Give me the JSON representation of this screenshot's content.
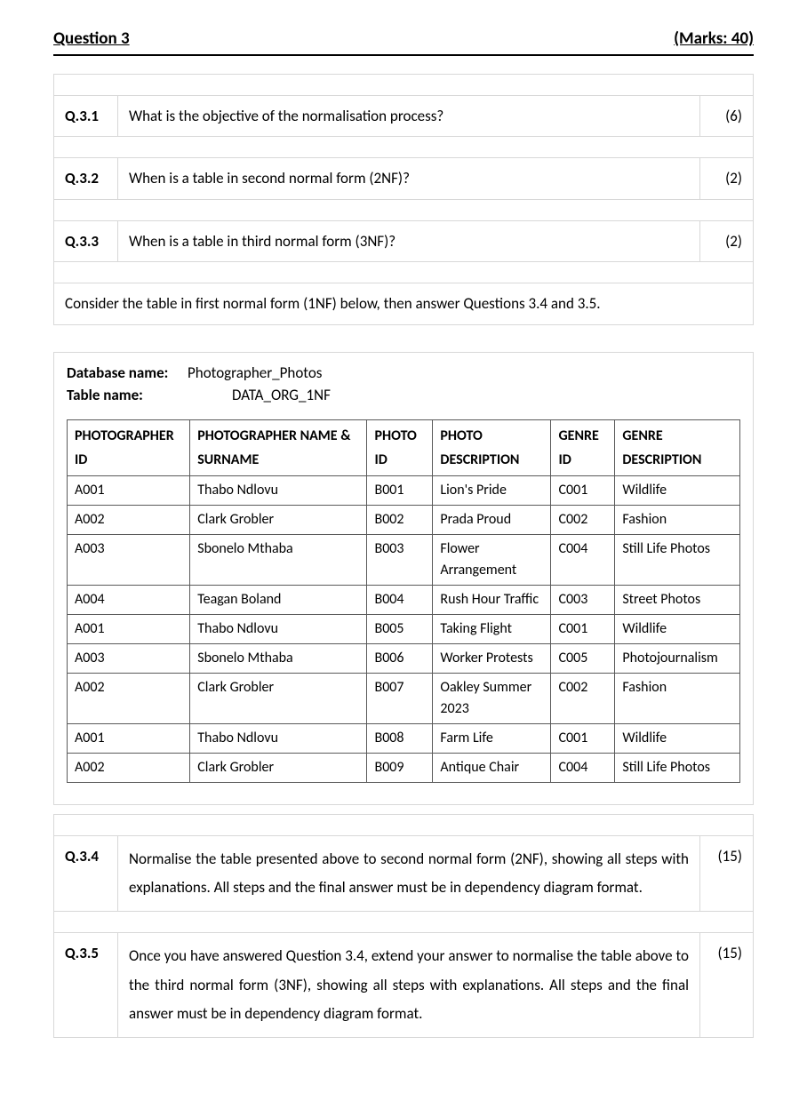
{
  "header": {
    "title": "Question 3",
    "marks": "(Marks: 40)"
  },
  "q31": {
    "num": "Q.3.1",
    "text": "What is the objective of the normalisation process?",
    "marks": "(6)"
  },
  "q32": {
    "num": "Q.3.2",
    "text": "When is a table in second normal form (2NF)?",
    "marks": "(2)"
  },
  "q33": {
    "num": "Q.3.3",
    "text": "When is a table in third normal form (3NF)?",
    "marks": "(2)"
  },
  "instruction": "Consider the table in first normal form (1NF) below, then answer Questions 3.4 and 3.5.",
  "db": {
    "name_label": "Database name:",
    "name_value": "Photographer_Photos",
    "table_label": "Table name:",
    "table_value": "DATA_ORG_1NF"
  },
  "columns": {
    "c1": "PHOTOGRAPHER ID",
    "c2": "PHOTOGRAPHER NAME & SURNAME",
    "c3": "PHOTO ID",
    "c4": "PHOTO DESCRIPTION",
    "c5": "GENRE ID",
    "c6": "GENRE DESCRIPTION"
  },
  "rows": [
    {
      "c1": "A001",
      "c2": "Thabo Ndlovu",
      "c3": "B001",
      "c4": "Lion's Pride",
      "c5": "C001",
      "c6": "Wildlife"
    },
    {
      "c1": "A002",
      "c2": "Clark Grobler",
      "c3": "B002",
      "c4": "Prada Proud",
      "c5": "C002",
      "c6": "Fashion"
    },
    {
      "c1": "A003",
      "c2": "Sbonelo Mthaba",
      "c3": "B003",
      "c4": "Flower Arrangement",
      "c5": "C004",
      "c6": "Still Life Photos"
    },
    {
      "c1": "A004",
      "c2": "Teagan Boland",
      "c3": "B004",
      "c4": "Rush Hour Traffic",
      "c5": "C003",
      "c6": "Street Photos"
    },
    {
      "c1": "A001",
      "c2": "Thabo Ndlovu",
      "c3": "B005",
      "c4": "Taking Flight",
      "c5": "C001",
      "c6": "Wildlife"
    },
    {
      "c1": "A003",
      "c2": "Sbonelo Mthaba",
      "c3": "B006",
      "c4": "Worker Protests",
      "c5": "C005",
      "c6": "Photojournalism"
    },
    {
      "c1": "A002",
      "c2": "Clark Grobler",
      "c3": "B007",
      "c4": "Oakley Summer 2023",
      "c5": "C002",
      "c6": "Fashion"
    },
    {
      "c1": "A001",
      "c2": "Thabo Ndlovu",
      "c3": "B008",
      "c4": "Farm Life",
      "c5": "C001",
      "c6": "Wildlife"
    },
    {
      "c1": "A002",
      "c2": "Clark Grobler",
      "c3": "B009",
      "c4": "Antique Chair",
      "c5": "C004",
      "c6": "Still Life Photos"
    }
  ],
  "q34": {
    "num": "Q.3.4",
    "text": "Normalise the table presented above to second normal form (2NF), showing all steps with explanations. All steps and the final answer must be in dependency diagram format.",
    "marks": "(15)"
  },
  "q35": {
    "num": "Q.3.5",
    "text": "Once you have answered Question 3.4, extend your answer to normalise the table above to the third normal form (3NF), showing all steps with explanations. All steps and the final answer must be in dependency diagram format.",
    "marks": "(15)"
  }
}
